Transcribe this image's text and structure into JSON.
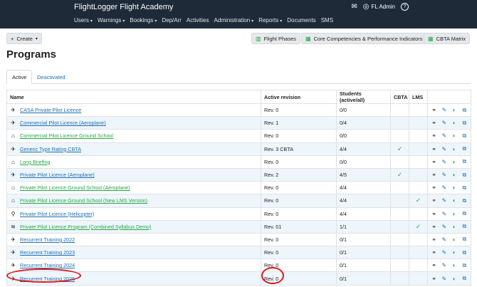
{
  "header": {
    "app_title": "FlightLogger Flight Academy",
    "user_name": "FL Admin",
    "mail_icon": "envelope-icon",
    "help_icon": "question-icon",
    "nav": [
      {
        "label": "Users",
        "dropdown": true
      },
      {
        "label": "Warnings",
        "dropdown": true
      },
      {
        "label": "Bookings",
        "dropdown": true
      },
      {
        "label": "Dep/Arr",
        "dropdown": false
      },
      {
        "label": "Activities",
        "dropdown": false
      },
      {
        "label": "Administration",
        "dropdown": true
      },
      {
        "label": "Reports",
        "dropdown": true
      },
      {
        "label": "Documents",
        "dropdown": false
      },
      {
        "label": "SMS",
        "dropdown": false
      }
    ]
  },
  "toolbar": {
    "create_label": "Create",
    "flight_phases_label": "Flight Phases",
    "core_comp_label": "Core Competencies & Performance Indicators",
    "cbta_matrix_label": "CBTA Matrix"
  },
  "page": {
    "title": "Programs",
    "tabs": [
      {
        "label": "Active",
        "active": true
      },
      {
        "label": "Deactivated",
        "active": false
      }
    ]
  },
  "table": {
    "headers": {
      "name": "Name",
      "revision": "Active revision",
      "students": "Students (active/all)",
      "cbta": "CBTA",
      "lms": "LMS"
    },
    "rows": [
      {
        "icon": "airplane-icon",
        "glyph": "✈",
        "name": "CASA Private Pilot Licence",
        "link_color": "blue",
        "revision": "Rev. 0",
        "students": "0/0",
        "cbta": "",
        "lms": ""
      },
      {
        "icon": "airplane-icon",
        "glyph": "✈",
        "name": "Commercial Pilot Licence (Aeroplane)",
        "link_color": "blue",
        "revision": "Rev. 1",
        "students": "0/4",
        "cbta": "",
        "lms": ""
      },
      {
        "icon": "classroom-icon",
        "glyph": "⌂",
        "name": "Commercial Pilot Licence Ground School",
        "link_color": "green",
        "revision": "Rev. 0",
        "students": "0/0",
        "cbta": "",
        "lms": ""
      },
      {
        "icon": "airplane-icon",
        "glyph": "✈",
        "name": "Generic Type Rating CBTA",
        "link_color": "blue",
        "revision": "Rev. 3 CBTA",
        "students": "4/4",
        "cbta": "✓",
        "lms": ""
      },
      {
        "icon": "classroom-icon",
        "glyph": "⌂",
        "name": "Long Briefing",
        "link_color": "green",
        "revision": "Rev. 0",
        "students": "0/0",
        "cbta": "",
        "lms": ""
      },
      {
        "icon": "airplane-icon",
        "glyph": "✈",
        "name": "Private Pilot Licence (Aeroplane)",
        "link_color": "blue",
        "revision": "Rev. 2",
        "students": "4/5",
        "cbta": "✓",
        "lms": ""
      },
      {
        "icon": "classroom-icon",
        "glyph": "⌂",
        "name": "Private Pilot Licence Ground School (Aeroplane)",
        "link_color": "green",
        "revision": "Rev. 0",
        "students": "4/4",
        "cbta": "",
        "lms": ""
      },
      {
        "icon": "classroom-icon",
        "glyph": "⌂",
        "name": "Private Pilot Licence Ground School (New LMS Version)",
        "link_color": "green",
        "revision": "Rev. 0",
        "students": "4/4",
        "cbta": "",
        "lms": "✓"
      },
      {
        "icon": "helicopter-icon",
        "glyph": "⚲",
        "name": "Private Pilot Licence (Helicopter)",
        "link_color": "blue",
        "revision": "Rev. 0",
        "students": "4/4",
        "cbta": "",
        "lms": ""
      },
      {
        "icon": "layers-icon",
        "glyph": "≋",
        "name": "Private Pilot Licence Program (Combined Syllabus Demo)",
        "link_color": "green",
        "revision": "Rev. 01",
        "students": "1/1",
        "cbta": "",
        "lms": "✓"
      },
      {
        "icon": "airplane-icon",
        "glyph": "✈",
        "name": "Recurrent Training 2022",
        "link_color": "blue",
        "revision": "Rev. 0",
        "students": "0/1",
        "cbta": "",
        "lms": ""
      },
      {
        "icon": "airplane-icon",
        "glyph": "✈",
        "name": "Recurrent Training 2023",
        "link_color": "blue",
        "revision": "Rev. 0",
        "students": "0/1",
        "cbta": "",
        "lms": ""
      },
      {
        "icon": "airplane-icon",
        "glyph": "✈",
        "name": "Recurrent Training 2024",
        "link_color": "blue",
        "revision": "Rev. 0",
        "students": "0/1",
        "cbta": "",
        "lms": ""
      },
      {
        "icon": "airplane-icon",
        "glyph": "✈",
        "name": "Recurrent Training 2026",
        "link_color": "blue",
        "revision": "Rev. 0",
        "students": "0/1",
        "cbta": "",
        "lms": ""
      }
    ],
    "actions": [
      {
        "icon": "share-icon",
        "glyph": "⚭"
      },
      {
        "icon": "pencil-icon",
        "glyph": "✎"
      },
      {
        "icon": "toggle-icon",
        "glyph": "◐"
      },
      {
        "icon": "copy-icon",
        "glyph": "⧉"
      }
    ]
  },
  "colors": {
    "topbar": "#1e2a38",
    "link_blue": "#1f6fb2",
    "link_green": "#28a745",
    "highlight_ring": "#e0191c",
    "row_alt": "#eef6fc"
  }
}
